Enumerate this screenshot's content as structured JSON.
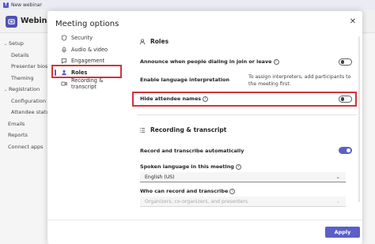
{
  "titlebar": {
    "text": "New webinar"
  },
  "app": {
    "title": "Webinar"
  },
  "bg_nav": [
    {
      "label": "Setup",
      "level": 0,
      "chev": "⌄"
    },
    {
      "label": "Details",
      "level": 1
    },
    {
      "label": "Presenter bios",
      "level": 1
    },
    {
      "label": "Theming",
      "level": 1
    },
    {
      "label": "Registration",
      "level": 0,
      "chev": "⌄"
    },
    {
      "label": "Configuration",
      "level": 1
    },
    {
      "label": "Attendee status",
      "level": 1
    },
    {
      "label": "Emails",
      "level": 2
    },
    {
      "label": "Reports",
      "level": 2
    },
    {
      "label": "Connect apps",
      "level": 2
    }
  ],
  "dialog": {
    "title": "Meeting options",
    "close": "✕",
    "nav": [
      {
        "label": "Security",
        "icon": "shield-icon"
      },
      {
        "label": "Audio & video",
        "icon": "mic-icon"
      },
      {
        "label": "Engagement",
        "icon": "chat-icon"
      },
      {
        "label": "Roles",
        "icon": "person-icon",
        "active": true
      },
      {
        "label": "Recording & transcript",
        "icon": "recording-icon"
      }
    ],
    "roles": {
      "heading": "Roles",
      "announce_label": "Announce when people dialing in join or leave",
      "announce_on": false,
      "lang_label": "Enable language interpretation",
      "lang_note": "To assign interpreters, add participants to the meeting first.",
      "hide_label": "Hide attendee names",
      "hide_on": false
    },
    "recording": {
      "heading": "Recording & transcript",
      "auto_label": "Record and transcribe automatically",
      "auto_on": true,
      "spoken_label": "Spoken language in this meeting",
      "spoken_value": "English (US)",
      "who_label": "Who can record and transcribe",
      "who_value": "Organizers, co-organizers, and presenters"
    },
    "apply_label": "Apply"
  },
  "colors": {
    "accent": "#5b5fc7",
    "highlight": "#d13438"
  }
}
